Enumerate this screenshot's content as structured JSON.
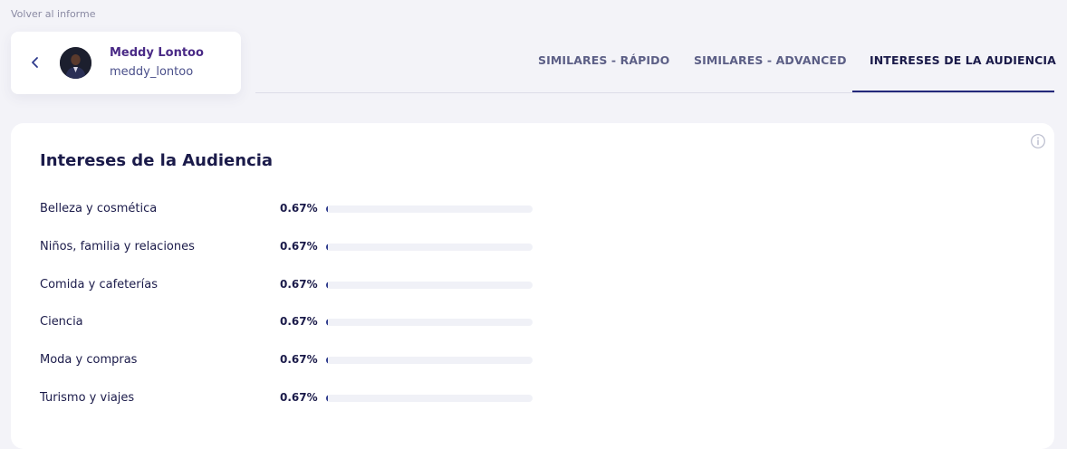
{
  "header": {
    "back_link": "Volver al informe"
  },
  "profile": {
    "name": "Meddy Lontoo",
    "handle": "meddy_lontoo"
  },
  "tabs": [
    {
      "label": "SIMILARES - RÁPIDO",
      "active": false
    },
    {
      "label": "SIMILARES - ADVANCED",
      "active": false
    },
    {
      "label": "INTERESES DE LA AUDIENCIA",
      "active": true
    }
  ],
  "panel": {
    "title": "Intereses de la Audiencia",
    "interests": [
      {
        "label": "Belleza y cosmética",
        "percent_label": "0.67%",
        "percent": 0.67
      },
      {
        "label": "Niños, familia y relaciones",
        "percent_label": "0.67%",
        "percent": 0.67
      },
      {
        "label": "Comida y cafeterías",
        "percent_label": "0.67%",
        "percent": 0.67
      },
      {
        "label": "Ciencia",
        "percent_label": "0.67%",
        "percent": 0.67
      },
      {
        "label": "Moda y compras",
        "percent_label": "0.67%",
        "percent": 0.67
      },
      {
        "label": "Turismo y viajes",
        "percent_label": "0.67%",
        "percent": 0.67
      }
    ]
  },
  "colors": {
    "accent": "#23287a",
    "bar_fill": "#2d3a8c",
    "bar_track": "#f0f1f7",
    "name": "#4a2a86"
  },
  "icons": {
    "back": "chevron-left-icon",
    "info": "info-icon"
  }
}
